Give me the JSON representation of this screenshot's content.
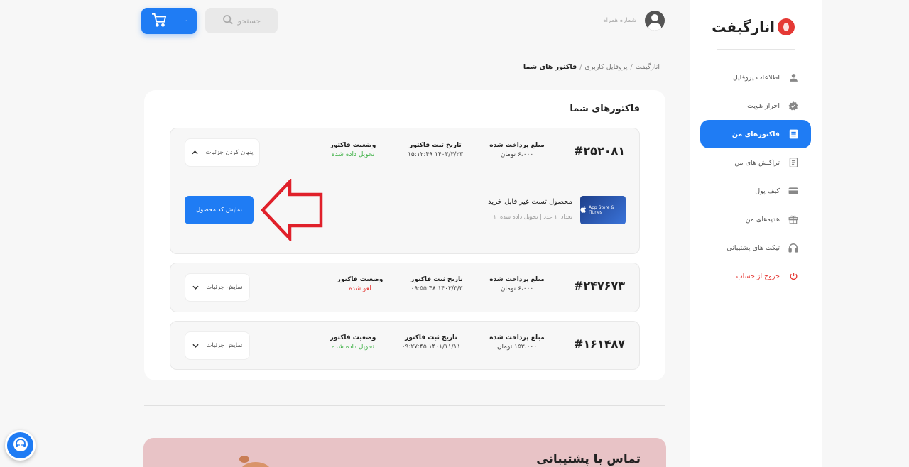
{
  "brand": {
    "name": "انارگیفت"
  },
  "sidebar": {
    "items": [
      {
        "label": "اطلاعات پروفایل",
        "icon": "user-icon"
      },
      {
        "label": "احراز هویت",
        "icon": "verified-badge-icon"
      },
      {
        "label": "فاکتورهای من",
        "icon": "invoice-icon",
        "active": true
      },
      {
        "label": "تراکنش های من",
        "icon": "receipt-icon"
      },
      {
        "label": "کیف پول",
        "icon": "wallet-icon"
      },
      {
        "label": "هدیه‌های من",
        "icon": "gift-icon"
      },
      {
        "label": "تیکت های پشتیبانی",
        "icon": "headset-icon"
      },
      {
        "label": "خروج از حساب",
        "icon": "power-icon"
      }
    ]
  },
  "header": {
    "cart_count": "۰",
    "search_label": "جستجو",
    "phone_label": "شماره همراه"
  },
  "breadcrumb": {
    "home": "انارگیفت",
    "profile": "پروفایل کاربری",
    "current": "فاکتور های شما"
  },
  "invoices_section": {
    "title": "فاکتورهای شما",
    "labels": {
      "paid": "مبلغ پرداخت شده",
      "date": "تاریخ ثبت فاکتور",
      "status": "وضعیت فاکتور"
    },
    "invoices": [
      {
        "number": "#۲۵۲۰۸۱",
        "amount": "۶،۰۰۰ تومان",
        "date": "۱۴۰۳/۳/۲۳ ۱۵:۱۲:۴۹",
        "status": "تحویل داده شده",
        "toggle_label": "پنهان کردن جزئیات",
        "product": {
          "name": "محصول تست غیر قابل خرید",
          "meta": "تعداد: ۱ عدد | تحویل داده شده: ۱",
          "thumb_text": "App Store & iTunes",
          "button": "نمایش کد محصول"
        }
      },
      {
        "number": "#۲۴۷۶۷۳",
        "amount": "۶،۰۰۰ تومان",
        "date": "۱۴۰۳/۳/۳ ۰۹:۵۵:۴۸",
        "status": "لغو شده",
        "toggle_label": "نمایش جزئیات"
      },
      {
        "number": "#۱۶۱۴۸۷",
        "amount": "۱۵۳،۰۰۰ تومان",
        "date": "۱۴۰۱/۱۱/۱۱ ۰۹:۲۷:۴۵",
        "status": "تحویل داده شده",
        "toggle_label": "نمایش جزئیات"
      }
    ]
  },
  "support": {
    "title": "تماس با پشتیبانی"
  },
  "colors": {
    "accent": "#1f7cf4",
    "success": "#43b34a",
    "danger": "#e53935",
    "annotation": "#e0202a",
    "banner": "#e8c3c6"
  }
}
